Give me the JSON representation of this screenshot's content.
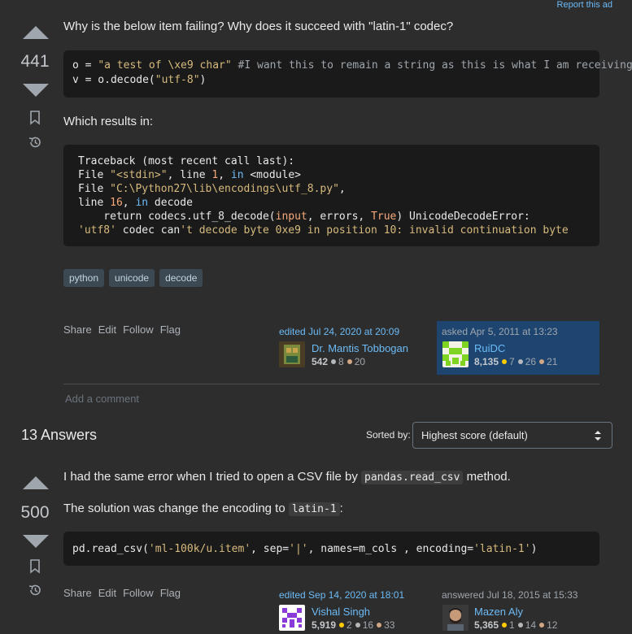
{
  "report_ad": "Report this ad",
  "question": {
    "score": "441",
    "title_line": "Why is the below item failing? Why does it succeed with \"latin-1\" codec?",
    "code1": {
      "line1_prefix": "o = ",
      "line1_string": "\"a test of \\xe9 char\"",
      "line1_comment": " #I want this to remain a string as this is what I am receiving",
      "line2_prefix": "v = o.decode(",
      "line2_string": "\"utf-8\"",
      "line2_suffix": ")"
    },
    "results_text": "Which results in:",
    "traceback": {
      "l1": "Traceback (most recent call last):",
      "l2_a": "File ",
      "l2_b": "\"<stdin>\"",
      "l2_c": ", line ",
      "l2_d": "1",
      "l2_e": ", ",
      "l2_f": "in",
      "l2_g": " <module>",
      "l3_a": "File ",
      "l3_b": "\"C:\\Python27\\lib\\encodings\\utf_8.py\"",
      "l3_c": ",",
      "l4_a": "line ",
      "l4_b": "16",
      "l4_c": ", ",
      "l4_d": "in",
      "l4_e": " decode",
      "l5_a": "    return codecs.utf_8_decode(",
      "l5_b": "input",
      "l5_c": ", errors, ",
      "l5_d": "True",
      "l5_e": ") UnicodeDecodeError:",
      "l6_a": "'utf8'",
      "l6_b": " codec can",
      "l6_c": "'t decode byte 0xe9 in position 10: invalid continuation byte"
    },
    "tags": [
      "python",
      "unicode",
      "decode"
    ],
    "actions": [
      "Share",
      "Edit",
      "Follow",
      "Flag"
    ],
    "editor": {
      "label": "edited Jul 24, 2020 at 20:09",
      "name": "Dr. Mantis Tobbogan",
      "rep": "542",
      "gold": "",
      "silver": "8",
      "bronze": "20"
    },
    "asker": {
      "label": "asked Apr 5, 2011 at 13:23",
      "name": "RuiDC",
      "rep": "8,135",
      "gold": "7",
      "silver": "26",
      "bronze": "21"
    },
    "add_comment": "Add a comment"
  },
  "answers_header": {
    "count_label": "13 Answers",
    "sorted_by": "Sorted by:",
    "sort_value": "Highest score (default)"
  },
  "answer": {
    "score": "500",
    "p1_before": "I had the same error when I tried to open a CSV file by ",
    "p1_code": "pandas.read_csv",
    "p1_after": " method.",
    "p2_before": "The solution was change the encoding to ",
    "p2_code": "latin-1",
    "p2_after": ":",
    "code": {
      "a": "pd.read_csv(",
      "b": "'ml-100k/u.item'",
      "c": ", sep=",
      "d": "'|'",
      "e": ", names=m_cols , encoding=",
      "f": "'latin-1'",
      "g": ")"
    },
    "actions": [
      "Share",
      "Edit",
      "Follow",
      "Flag"
    ],
    "editor": {
      "label": "edited Sep 14, 2020 at 18:01",
      "name": "Vishal Singh",
      "rep": "5,919",
      "gold": "2",
      "silver": "16",
      "bronze": "33"
    },
    "author": {
      "label": "answered Jul 18, 2015 at 15:33",
      "name": "Mazen Aly",
      "rep": "5,365",
      "gold": "1",
      "silver": "14",
      "bronze": "12"
    }
  },
  "colors": {
    "background": "#2d2d2d",
    "code_bg": "#1a1a1a",
    "link": "#6cbbf7",
    "op_card": "#1e4570",
    "tag_bg": "#3d4952"
  },
  "icons": [
    "bookmark-icon",
    "history-icon",
    "vote-up-arrow-icon",
    "vote-down-arrow-icon",
    "sort-chevron-icon"
  ]
}
